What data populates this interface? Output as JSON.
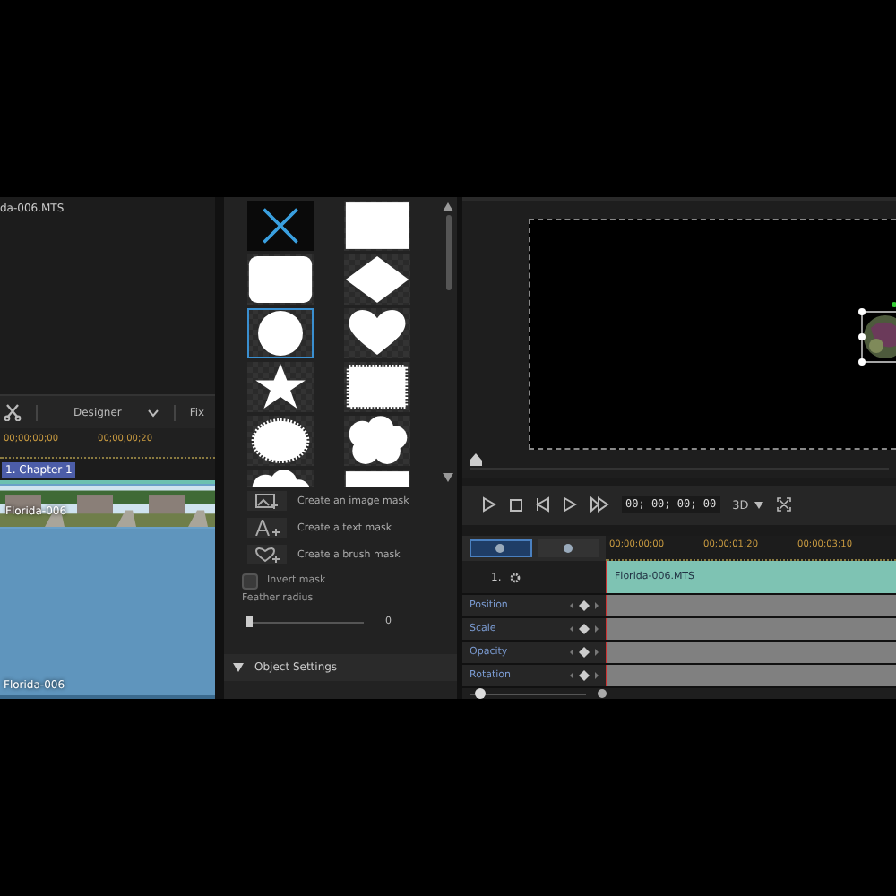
{
  "library": {
    "file_name": "da-006.MTS"
  },
  "timeline": {
    "mode": "Designer",
    "button_3": "Fix",
    "ruler_ticks": [
      "00;00;00;00",
      "00;00;00;20"
    ],
    "chapter": "1. Chapter 1",
    "video_clip": "Florida-006",
    "audio_clip": "Florida-006"
  },
  "mask_panel": {
    "shapes": [
      {
        "kind": "none",
        "selected": false
      },
      {
        "kind": "rect",
        "selected": false
      },
      {
        "kind": "rounded",
        "selected": false
      },
      {
        "kind": "diamond",
        "selected": false
      },
      {
        "kind": "circle",
        "selected": true
      },
      {
        "kind": "heart",
        "selected": false
      },
      {
        "kind": "star",
        "selected": false
      },
      {
        "kind": "stamp",
        "selected": false
      },
      {
        "kind": "seal",
        "selected": false
      },
      {
        "kind": "cloud",
        "selected": false
      },
      {
        "kind": "cloud",
        "selected": false
      },
      {
        "kind": "rect",
        "selected": false
      }
    ],
    "actions": [
      {
        "label": "Create an image mask"
      },
      {
        "kind": "text",
        "label": "Create a text mask"
      },
      {
        "kind": "brush",
        "label": "Create a brush mask"
      }
    ],
    "invert_mask": {
      "label": "Invert mask",
      "checked": false
    },
    "feather": {
      "label": "Feather radius",
      "level": 0,
      "reading": "0"
    },
    "section": {
      "label": "Object Settings",
      "expanded": true
    }
  },
  "player": {
    "seek": {
      "level": 0
    },
    "timecode": "00; 00; 00; 00",
    "mode_3d": "3D"
  },
  "keyframes": {
    "tabs": [
      {
        "selected": true
      },
      {
        "selected": false
      }
    ],
    "ruler_ticks": [
      "00;00;00;00",
      "00;00;01;20",
      "00;00;03;10"
    ],
    "track_label": "1.",
    "clip": "Florida-006.MTS",
    "attributes": [
      "Position",
      "Scale",
      "Opacity",
      "Rotation"
    ],
    "zoom": {
      "level": 0.05
    }
  }
}
